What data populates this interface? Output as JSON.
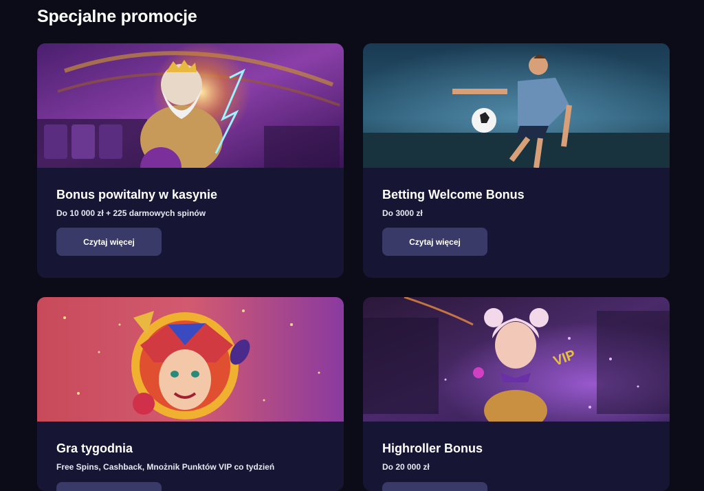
{
  "section": {
    "title": "Specjalne promocje"
  },
  "promotions": [
    {
      "title": "Bonus powitalny w kasynie",
      "subtitle": "Do 10 000 zł + 225 darmowych spinów",
      "button": "Czytaj więcej",
      "image": "zeus-casino-banner"
    },
    {
      "title": "Betting Welcome Bonus",
      "subtitle": "Do 3000 zł",
      "button": "Czytaj więcej",
      "image": "football-player-banner"
    },
    {
      "title": "Gra tygodnia",
      "subtitle": "Free Spins, Cashback, Mnożnik Punktów VIP co tydzień",
      "button": "",
      "image": "jester-banner"
    },
    {
      "title": "Highroller Bonus",
      "subtitle": "Do 20 000 zł",
      "button": "",
      "image": "vip-girl-banner"
    }
  ],
  "colors": {
    "background": "#0c0b18",
    "card": "#161634",
    "button": "#3a3a68"
  }
}
